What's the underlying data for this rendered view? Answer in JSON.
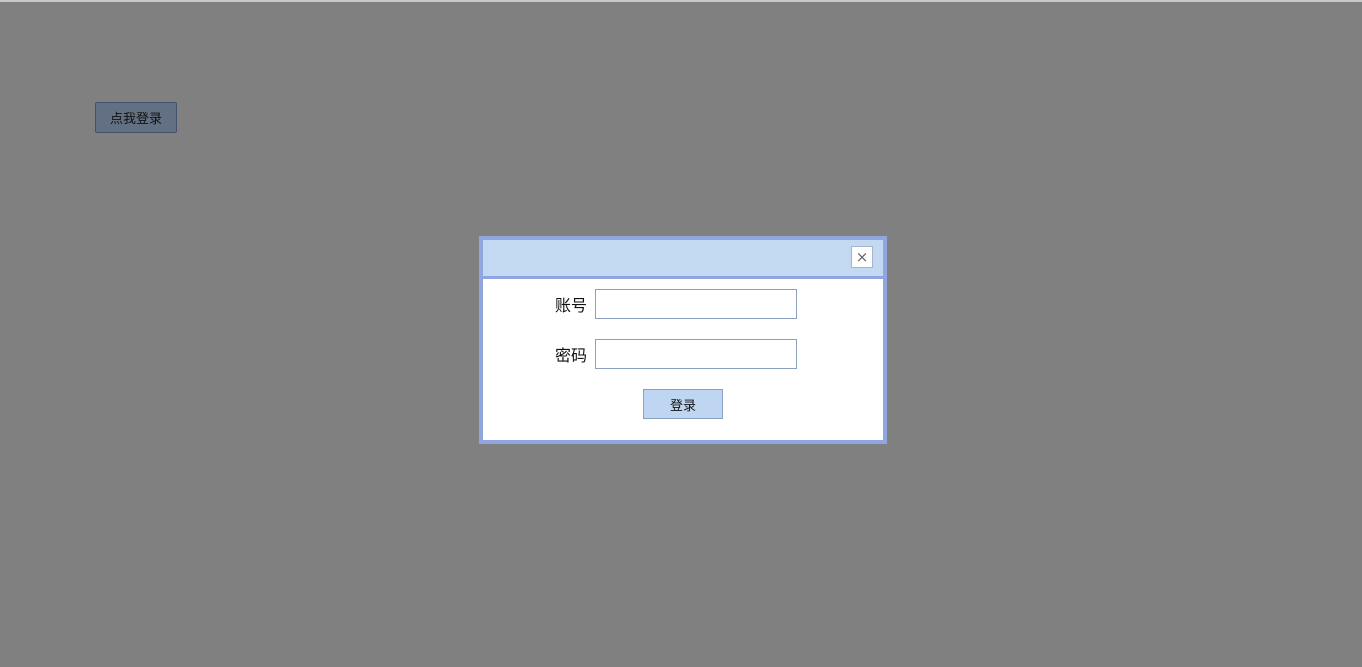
{
  "page": {
    "open_login_label": "点我登录"
  },
  "dialog": {
    "close_icon": "close-icon",
    "close_glyph": "×",
    "account_label": "账号",
    "account_value": "",
    "password_label": "密码",
    "password_value": "",
    "submit_label": "登录"
  },
  "colors": {
    "overlay": "#808080",
    "dialog_border": "#8fa6e0",
    "header_bg": "#c2d9f1",
    "submit_bg": "#bed6f1",
    "open_button_bg": "#637083"
  }
}
